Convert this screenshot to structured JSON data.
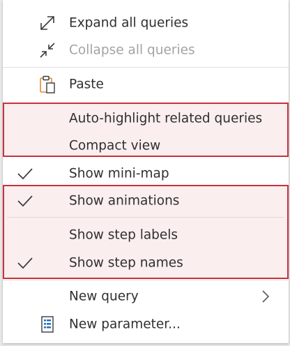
{
  "menu": {
    "items": [
      {
        "label": "Expand all queries",
        "icon": "expand-arrows-icon",
        "checked": false,
        "disabled": false
      },
      {
        "label": "Collapse all queries",
        "icon": "collapse-arrows-icon",
        "checked": false,
        "disabled": true
      },
      {
        "label": "Paste",
        "icon": "paste-clipboard-icon",
        "checked": false,
        "disabled": false
      },
      {
        "label": "Auto-highlight related queries",
        "checked": false,
        "highlighted": true
      },
      {
        "label": "Compact view",
        "checked": false,
        "highlighted": true
      },
      {
        "label": "Show mini-map",
        "checked": true
      },
      {
        "label": "Show animations",
        "checked": true,
        "highlighted": true
      },
      {
        "label": "Show step labels",
        "checked": false,
        "highlighted": true
      },
      {
        "label": "Show step names",
        "checked": true,
        "highlighted": true
      },
      {
        "label": "New query",
        "has_submenu": true,
        "icon": "chevron-right-icon"
      },
      {
        "label": "New parameter...",
        "icon": "parameter-icon"
      }
    ]
  },
  "colors": {
    "highlight_border": "#c9323c",
    "highlight_fill": "#faeeee",
    "icon_blue": "#1f6fbf",
    "paste_orange": "#e08a2c"
  }
}
